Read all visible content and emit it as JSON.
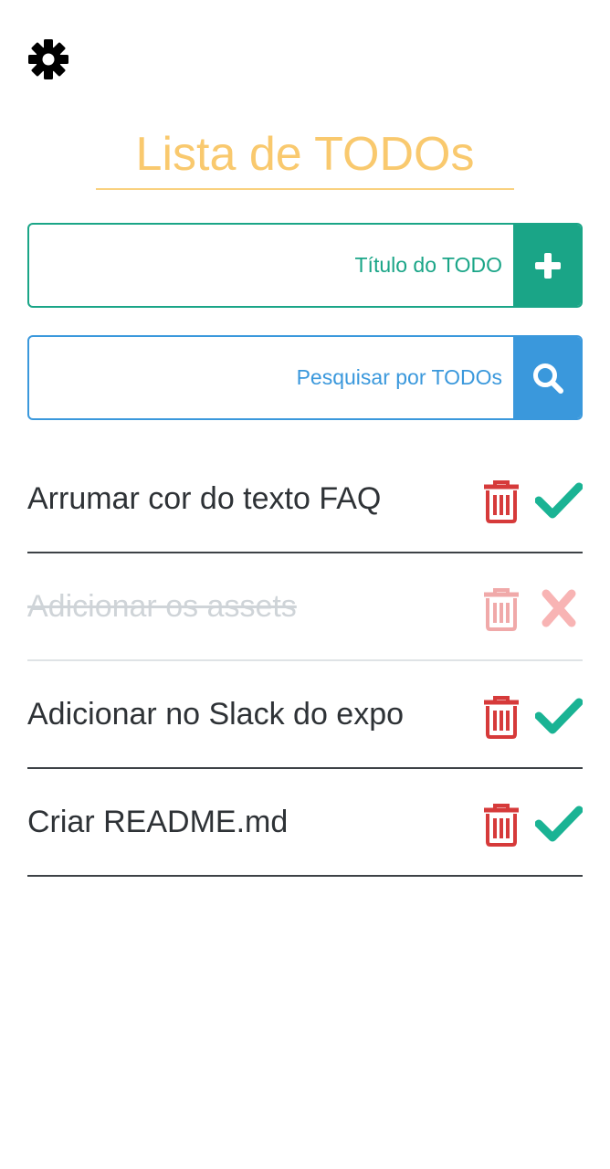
{
  "header": {
    "settings_icon": "gear-icon",
    "title": "Lista de TODOs",
    "title_color": "#f9c96e"
  },
  "add_form": {
    "placeholder": "Título do TODO",
    "value": "",
    "button_icon": "plus-icon",
    "accent_color": "#1aa587"
  },
  "search_form": {
    "placeholder": "Pesquisar por TODOs",
    "value": "",
    "button_icon": "search-icon",
    "accent_color": "#3a98dc"
  },
  "todos": [
    {
      "text": "Arrumar cor do texto FAQ",
      "done": false,
      "delete_icon": "trash-icon",
      "toggle_icon": "check-icon"
    },
    {
      "text": "Adicionar os assets",
      "done": true,
      "delete_icon": "trash-icon",
      "toggle_icon": "x-icon"
    },
    {
      "text": "Adicionar no Slack do expo",
      "done": false,
      "delete_icon": "trash-icon",
      "toggle_icon": "check-icon"
    },
    {
      "text": "Criar README.md",
      "done": false,
      "delete_icon": "trash-icon",
      "toggle_icon": "check-icon"
    }
  ],
  "colors": {
    "delete": "#d63a3a",
    "check": "#1ab394",
    "undo": "#f8b4b4"
  }
}
